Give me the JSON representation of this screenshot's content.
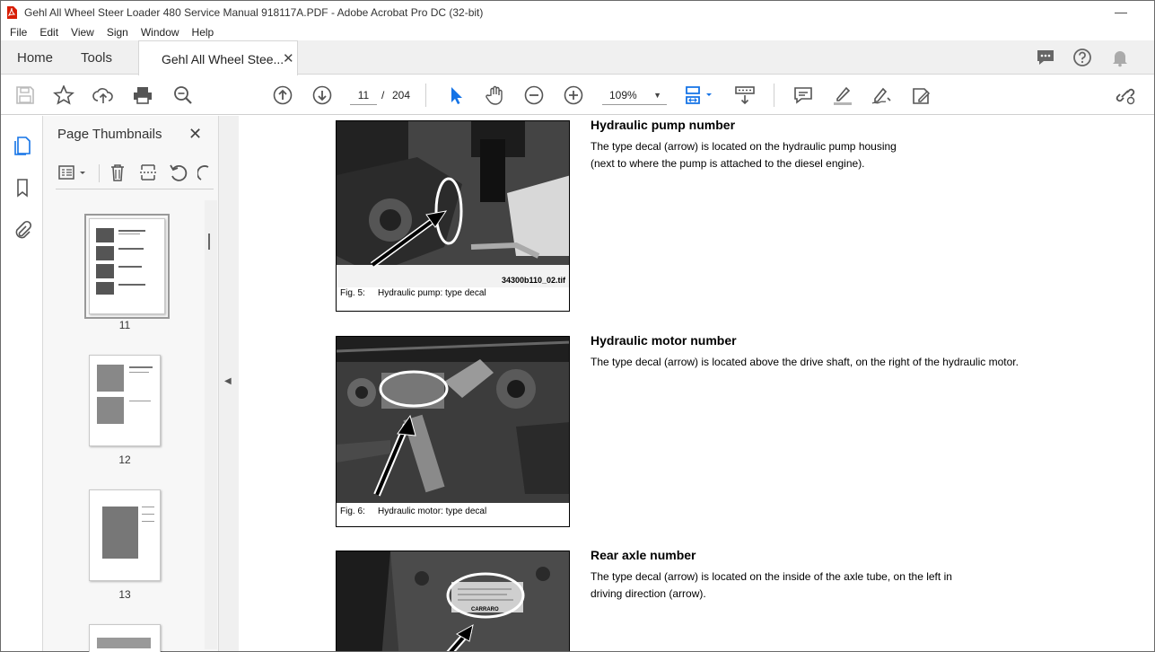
{
  "window": {
    "title": "Gehl All Wheel Steer Loader 480 Service Manual 918117A.PDF - Adobe Acrobat Pro DC (32-bit)"
  },
  "menu": [
    "File",
    "Edit",
    "View",
    "Sign",
    "Window",
    "Help"
  ],
  "tabs": {
    "home": "Home",
    "tools": "Tools",
    "document": "Gehl All Wheel Stee..."
  },
  "toolbar": {
    "current_page": "11",
    "page_separator": "/",
    "total_pages": "204",
    "zoom": "109%"
  },
  "thumbnails_panel": {
    "title": "Page Thumbnails",
    "pages": [
      {
        "number": "11",
        "selected": true
      },
      {
        "number": "12",
        "selected": false
      },
      {
        "number": "13",
        "selected": false
      }
    ]
  },
  "document": {
    "sections": [
      {
        "heading": "Hydraulic pump number",
        "text_lines": [
          "The type decal (arrow) is located on the hydraulic pump housing",
          "(next to where the pump is attached to the diesel engine)."
        ],
        "figure_number": "Fig. 5:",
        "figure_caption": "Hydraulic pump: type decal",
        "figure_tag": "34300b110_02.tif"
      },
      {
        "heading": "Hydraulic motor number",
        "text_lines": [
          "The type decal (arrow) is located above the drive shaft, on the right of the hydraulic motor."
        ],
        "figure_number": "Fig. 6:",
        "figure_caption": "Hydraulic motor: type decal"
      },
      {
        "heading": "Rear axle number",
        "text_lines": [
          "The type decal (arrow) is located on the inside of the axle tube, on the left in",
          "driving direction (arrow)."
        ],
        "decal_text": "CARRARO"
      }
    ]
  },
  "colors": {
    "accent": "#1473e6",
    "toolbar_icon": "#555555",
    "tab_bar_bg": "#f0f0f0"
  }
}
